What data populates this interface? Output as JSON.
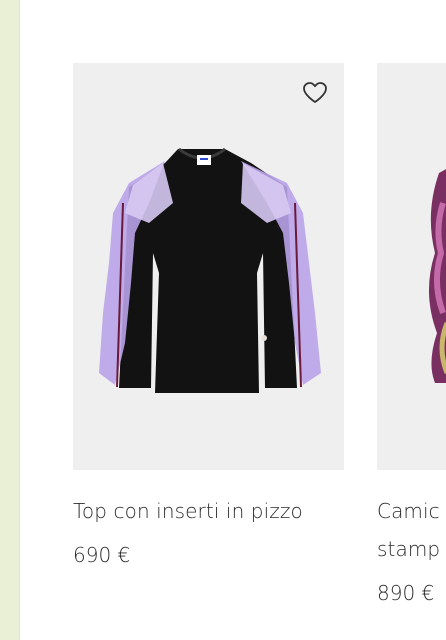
{
  "colors": {
    "strip": "#eaf0d6",
    "card_bg": "#efefef",
    "text": "#2a2a2a",
    "lace": "#b9a3e8",
    "garment": "#111111"
  },
  "products": [
    {
      "name": "Top con inserti in pizzo",
      "price": "690 €",
      "wishlist_icon": "heart-outline-icon"
    },
    {
      "name": "Camic stamp",
      "name_lines": [
        "Camic",
        "stamp"
      ],
      "price": "890 €"
    }
  ]
}
